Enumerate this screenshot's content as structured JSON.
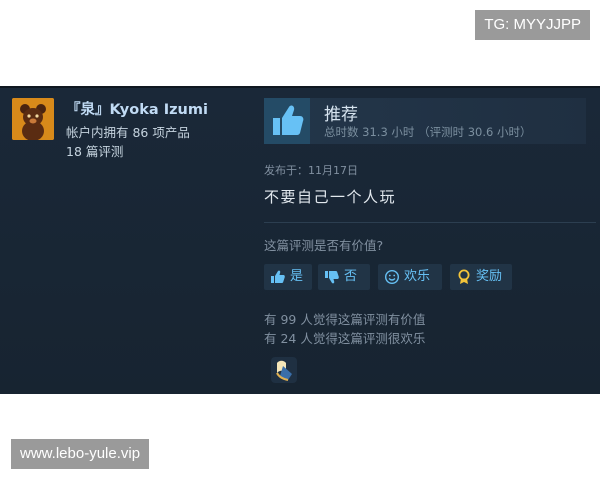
{
  "watermarks": {
    "top_right": "TG: MYYJJPP",
    "bottom_left": "www.lebo-yule.vip"
  },
  "author": {
    "name": "『泉』Kyoka Izumi",
    "products_owned": "帐户内拥有 86 项产品",
    "review_count": "18 篇评测",
    "avatar_icon": "bear-avatar-icon"
  },
  "recommendation": {
    "label": "推荐",
    "hours": "总时数 31.3 小时 （评测时 30.6 小时）",
    "icon": "thumbs-up-icon"
  },
  "review": {
    "posted": "发布于：11月17日",
    "text": "不要自己一个人玩"
  },
  "helpful": {
    "question": "这篇评测是否有价值?",
    "yes_label": "是",
    "no_label": "否",
    "funny_label": "欢乐",
    "award_label": "奖励"
  },
  "stats": {
    "helpful_count": "有 99 人觉得这篇评测有价值",
    "funny_count": "有 24 人觉得这篇评测很欢乐"
  },
  "colors": {
    "card_bg": "#1a2838",
    "link_blue": "#66c0f4",
    "thumb_box": "#244b66",
    "avatar_bg": "#d88a1a"
  }
}
